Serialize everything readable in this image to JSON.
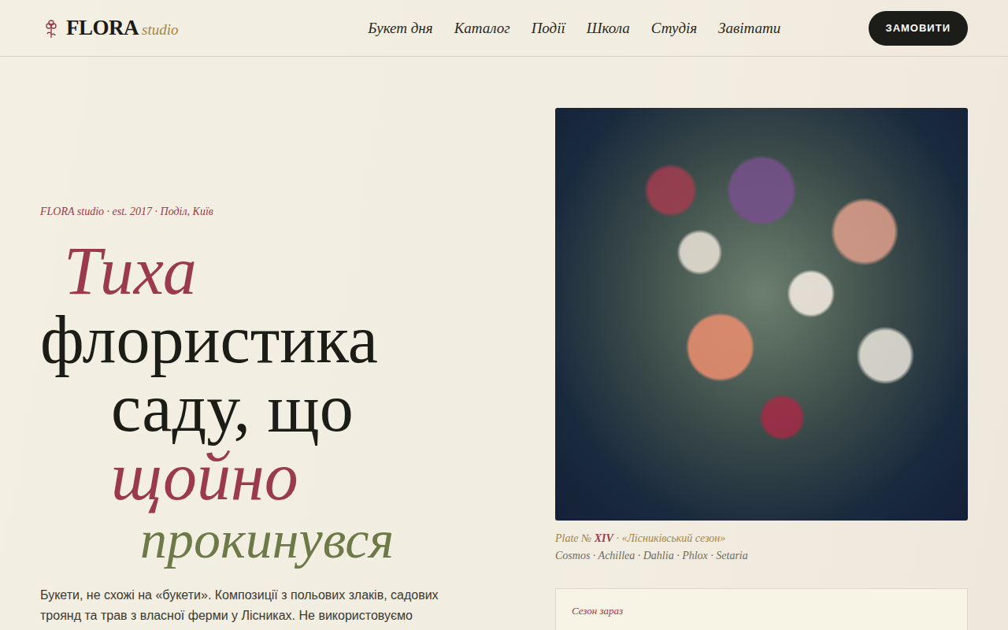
{
  "header": {
    "logo": {
      "name": "FLORA",
      "suffix": "studio"
    },
    "nav": [
      "Букет дня",
      "Каталог",
      "Події",
      "Школа",
      "Студія",
      "Завітати"
    ],
    "cta": "ЗАМОВИТИ"
  },
  "hero": {
    "eyebrow": "FLORA studio · est. 2017 · Поділ, Київ",
    "headline": [
      {
        "text": "Тиха",
        "kind": "accent"
      },
      {
        "text": "флористика",
        "kind": "plain"
      },
      {
        "text": "саду, що",
        "kind": "plain"
      },
      {
        "text": "щойно",
        "kind": "accent"
      },
      {
        "text": "прокинувся",
        "kind": "olive"
      }
    ],
    "lead": "Букети, не схожі на «букети». Композиції з польових злаків, садових троянд та трав з власної ферми у Лісниках. Не використовуємо"
  },
  "plate": {
    "prefix": "Plate № ",
    "number": "XIV",
    "title": " · «Лісниківський сезон»",
    "flowers": "Cosmos · Achillea · Dahlia · Phlox · Setaria"
  },
  "season": {
    "label": "Сезон зараз"
  }
}
